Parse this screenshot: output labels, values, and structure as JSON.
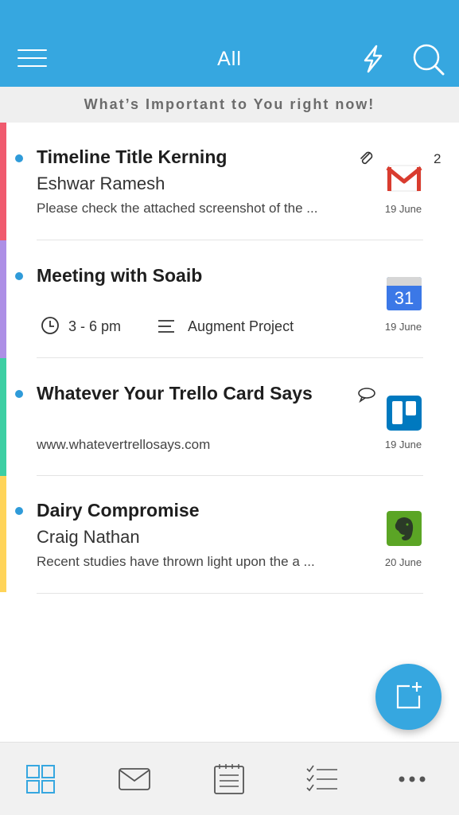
{
  "header": {
    "title": "All",
    "menu_icon": "hamburger-menu-icon",
    "flash_icon": "lightning-icon",
    "search_icon": "search-icon",
    "background": "#36a7e0"
  },
  "banner": {
    "text": "What’s Important to You right now!"
  },
  "cards": [
    {
      "accent": "#f05a6e",
      "title": "Timeline Title Kerning",
      "sender": "Eshwar Ramesh",
      "preview": "Please check the attached screenshot of the ...",
      "date": "19 June",
      "count": "2",
      "app_icon": "gmail-icon",
      "indicator_icon": "paperclip-icon"
    },
    {
      "accent": "#ad8fe6",
      "title": "Meeting with Soaib",
      "time": "3 - 6 pm",
      "project": "Augment Project",
      "date": "19 June",
      "app_icon": "google-calendar-icon",
      "calendar_day": "31"
    },
    {
      "accent": "#3dcfa3",
      "title": "Whatever Your Trello Card Says",
      "preview": "www.whatevertrellosays.com",
      "date": "19 June",
      "app_icon": "trello-icon",
      "indicator_icon": "comment-icon"
    },
    {
      "accent": "#ffd459",
      "title": "Dairy Compromise",
      "sender": "Craig Nathan",
      "preview": "Recent studies have thrown light upon the a ...",
      "date": "20 June",
      "app_icon": "evernote-icon"
    }
  ],
  "fab": {
    "icon": "compose-icon"
  },
  "bottom_nav": [
    {
      "icon": "grid-icon",
      "active": true
    },
    {
      "icon": "mail-icon",
      "active": false
    },
    {
      "icon": "notes-icon",
      "active": false
    },
    {
      "icon": "checklist-icon",
      "active": false
    },
    {
      "icon": "more-icon",
      "active": false
    }
  ]
}
